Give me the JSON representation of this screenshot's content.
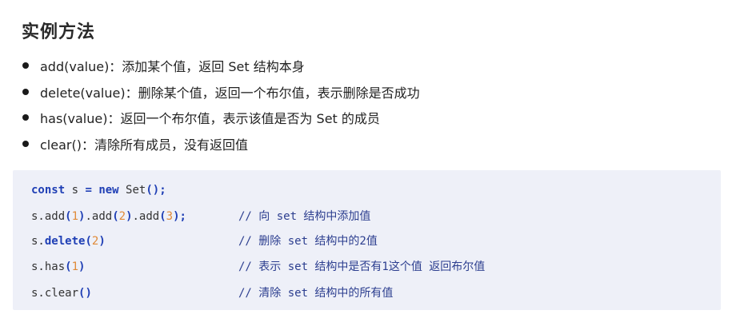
{
  "title": "实例方法",
  "bullets": [
    "add(value)：添加某个值，返回 Set 结构本身",
    "delete(value)：删除某个值，返回一个布尔值，表示删除是否成功",
    "has(value)：返回一个布尔值，表示该值是否为 Set 的成员",
    "clear()：清除所有成员，没有返回值"
  ],
  "code": {
    "line1": {
      "kw_const": "const",
      "s": " s ",
      "eq": "=",
      "sp": " ",
      "kw_new": "new",
      "set": " Set",
      "parens": "()",
      "semi": ";"
    },
    "line2": {
      "a": "s.add",
      "p1o": "(",
      "n1": "1",
      "p1c": ")",
      "b": ".add",
      "p2o": "(",
      "n2": "2",
      "p2c": ")",
      "c": ".add",
      "p3o": "(",
      "n3": "3",
      "p3c": ")",
      "semi": ";",
      "comment": "// 向 set 结构中添加值"
    },
    "line3": {
      "a": "s.",
      "kw_delete": "delete",
      "po": "(",
      "n": "2",
      "pc": ")",
      "comment": "// 删除 set 结构中的2值"
    },
    "line4": {
      "a": "s.has",
      "po": "(",
      "n": "1",
      "pc": ")",
      "comment": "// 表示 set 结构中是否有1这个值 返回布尔值"
    },
    "line5": {
      "a": "s.clear",
      "parens": "()",
      "comment": "// 清除 set 结构中的所有值"
    }
  },
  "colors": {
    "keyword": "#1f3fb5",
    "number": "#e08a38",
    "comment": "#2c3e8f",
    "code_background": "#eef0f8"
  }
}
